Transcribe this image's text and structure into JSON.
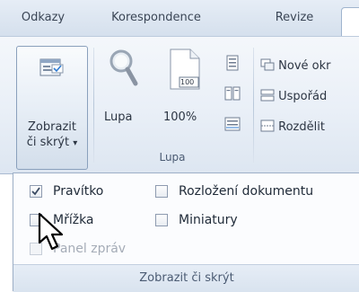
{
  "tabs": [
    {
      "label": "Odkazy"
    },
    {
      "label": "Korespondence"
    },
    {
      "label": "Revize"
    }
  ],
  "ribbon": {
    "show_hide_button": {
      "line1": "Zobrazit",
      "line2": "či skrýt",
      "chevron": "▾"
    },
    "zoom_group": {
      "label": "Lupa",
      "zoom_button": "Lupa",
      "hundred_percent_button": "100%",
      "hundred_icon_text": "100"
    },
    "window_group": {
      "new_window": "Nové okr",
      "arrange_all": "Uspořád",
      "split": "Rozdělit"
    }
  },
  "panel": {
    "title": "Zobrazit či skrýt",
    "items": [
      {
        "label": "Pravítko",
        "checked": true,
        "enabled": true
      },
      {
        "label": "Rozložení dokumentu",
        "checked": false,
        "enabled": true
      },
      {
        "label": "Mřížka",
        "checked": false,
        "enabled": true
      },
      {
        "label": "Miniatury",
        "checked": false,
        "enabled": true
      },
      {
        "label": "Panel zpráv",
        "checked": false,
        "enabled": false
      }
    ]
  }
}
